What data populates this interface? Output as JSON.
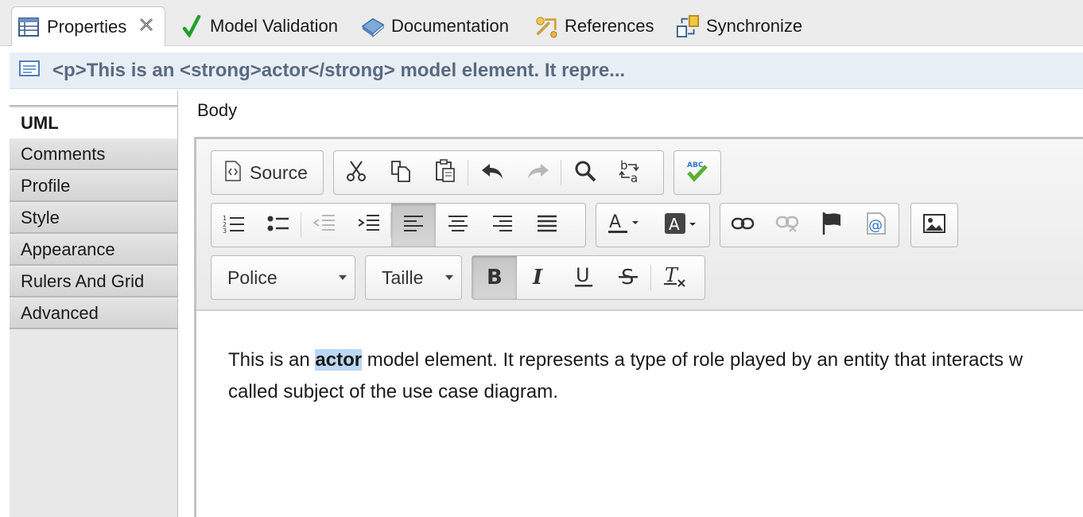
{
  "tabs": [
    {
      "label": "Properties",
      "icon": "properties-table-icon",
      "active": true
    },
    {
      "label": "Model Validation",
      "icon": "green-check-icon"
    },
    {
      "label": "Documentation",
      "icon": "book-icon"
    },
    {
      "label": "References",
      "icon": "references-icon"
    },
    {
      "label": "Synchronize",
      "icon": "synchronize-icon"
    }
  ],
  "title": "<p>This is an <strong>actor</strong> model element. It repre...",
  "categories": [
    "UML",
    "Comments",
    "Profile",
    "Style",
    "Appearance",
    "Rulers And Grid",
    "Advanced"
  ],
  "selected_category": "UML",
  "body_label": "Body",
  "toolbar": {
    "source_label": "Source",
    "font_combo": "Police",
    "size_combo": "Taille"
  },
  "content": {
    "line1_before": "This is an ",
    "line1_highlight": "actor",
    "line1_after": " model element. It represents a type of role played by an entity that interacts w",
    "line2": "called subject of the use case diagram."
  },
  "colors": {
    "accent": "#2f78c4",
    "title_text": "#5a6a80",
    "highlight": "#bcd7f5"
  }
}
